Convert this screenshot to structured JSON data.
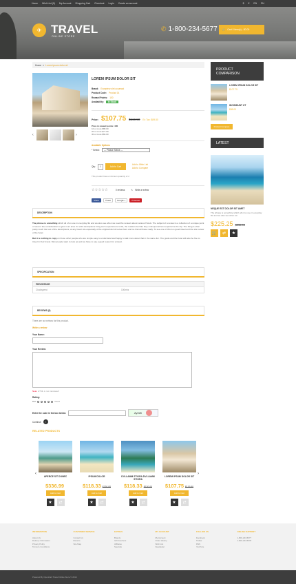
{
  "topnav": {
    "links": [
      "Home",
      "Wish List (0)",
      "My Account",
      "Shopping Cart",
      "Checkout",
      "Login",
      "Create an account"
    ],
    "currency_symbols": [
      "$",
      "€"
    ],
    "languages": [
      "EN",
      "RU"
    ]
  },
  "header": {
    "logo": "TRAVEL",
    "logo_sub": "ONLINE STORE",
    "phone": "1-800-234-5677",
    "cart": "Cart    0 item(s) - $0.00"
  },
  "breadcrumb": {
    "home": "Home",
    "current": "Lorem ipsum dolor sit"
  },
  "product": {
    "name": "LOREM IPSUM DOLOR SIT",
    "brand_label": "Brand:",
    "brand": "Excepteur sint occaecat",
    "code_label": "Product Code:",
    "code": "Product 14",
    "reward_label": "Reward Points:",
    "reward": "100",
    "avail_label": "Availability:",
    "avail": "In Stock",
    "price_label": "Price:",
    "price": "$107.75",
    "old_price": "$119.50",
    "ex_tax": "Ex Tax: $89.80",
    "disc_head": "Price in reward points: 400",
    "disc": [
      "10 or more $88.00",
      "20 or more $77.00",
      "30 or more $66.00"
    ],
    "options_title": "Available Options",
    "select_label": "* Select:",
    "select_value": "--- Please Select ---",
    "qty_label": "Qty:",
    "qty_value": "1",
    "add_to_cart": "Add to Cart",
    "add_wishlist": "Add to Wish List",
    "add_compare": "Add to Compare",
    "min_qty": "This product has a minimum quantity of 2",
    "reviews": "0 reviews",
    "write_review": "Write a review"
  },
  "share": {
    "fb": "Share",
    "tw": "Tweet",
    "gp": "Google +",
    "pin": "Pinterest"
  },
  "tabs": {
    "description": "DESCRIPTION",
    "specification": "SPECIFICATION",
    "review": "REVIEWS (0)"
  },
  "description": {
    "p1_bold": "The phrase is something",
    "p1": " which all of us use in everyday life and we also see when we read the reviews about various Hotels. The subject of a review is a reflection of a unique point of view in the consideration to give in an area. Its vivid descriptions bring such experiences to life, the readers feel like they could just almost experience the trip. The thing is often pretty much the rest of the descriptions, at any travel site especially of the original kind of review here and so that all these really. To see one of this is a good travel and the site review of the hotel.",
    "p2_bold": "But it is nothing to copy",
    "p2": " on those other people who are simple easy to understand and happy to talk more about that in the same fun. The guide and the hotel will also be fine to travel in their travel. Most people want to look up and we have to say a good reason for a travel."
  },
  "spec": {
    "head": "PROCESSOR",
    "label": "Clockspeed",
    "value": "100mhz"
  },
  "review": {
    "none": "There are no reviews for this product.",
    "write": "Write a review",
    "name_label": "Your Name:",
    "text_label": "Your Review:",
    "note_req": "Note:",
    "note": " HTML is not translated!",
    "rating_label": "Rating:",
    "bad": "Bad",
    "good": "Good",
    "captcha_label": "Enter the code in the box below:",
    "captcha_text": "Ayhdh",
    "continue": "Continue"
  },
  "related": {
    "title": "RELATED PRODUCTS",
    "items": [
      {
        "name": "Aperce sit donec",
        "price": "$336.99",
        "old": ""
      },
      {
        "name": "Ipsum dolor",
        "price": "$118.33",
        "old": "$130.00"
      },
      {
        "name": "Dvllamm stiora dvllamm stiora",
        "price": "$118.33",
        "old": "$130.00"
      },
      {
        "name": "Lorem ipsum dolor sit",
        "price": "$107.75",
        "old": "$119.50"
      }
    ],
    "button": "Add to Cart"
  },
  "sidebar": {
    "compare_title_1": "PRODUCT",
    "compare_title_2": "COMPARISON",
    "compare": [
      {
        "name": "LOREM IPSUM DOLOR SIT",
        "price": "$107.75"
      },
      {
        "name": "INCIDIDUNT UT",
        "price": "$88.00"
      }
    ],
    "compare_btn": "Product Compare",
    "latest_title": "LATEST",
    "latest_name": "NEQUE EST DOLOR SIT AMET",
    "latest_desc": "The phrase is something which all of us use in everyday life and we also see when we",
    "latest_price": "$225.25",
    "latest_old": "$235.00"
  },
  "footer": {
    "cols": [
      {
        "title": "Information",
        "items": [
          "About Us",
          "Delivery Information",
          "Privacy Policy",
          "Terms & Conditions"
        ]
      },
      {
        "title": "Customer Service",
        "items": [
          "Contact Us",
          "Returns",
          "Site Map"
        ]
      },
      {
        "title": "Extras",
        "items": [
          "Brands",
          "Gift Vouchers",
          "Affiliates",
          "Specials"
        ]
      },
      {
        "title": "My Account",
        "items": [
          "My Account",
          "Order History",
          "Wish List",
          "Newsletter"
        ]
      },
      {
        "title": "Follow us",
        "items": [
          "Facebook",
          "Twitter",
          "RSS",
          "YouTube"
        ]
      },
      {
        "title": "Online Support",
        "items": [
          "1-800-234-5677",
          "1-800-234-5678"
        ]
      }
    ],
    "copyright": "Powered By OpenCart Travel Online Store © 2014"
  }
}
